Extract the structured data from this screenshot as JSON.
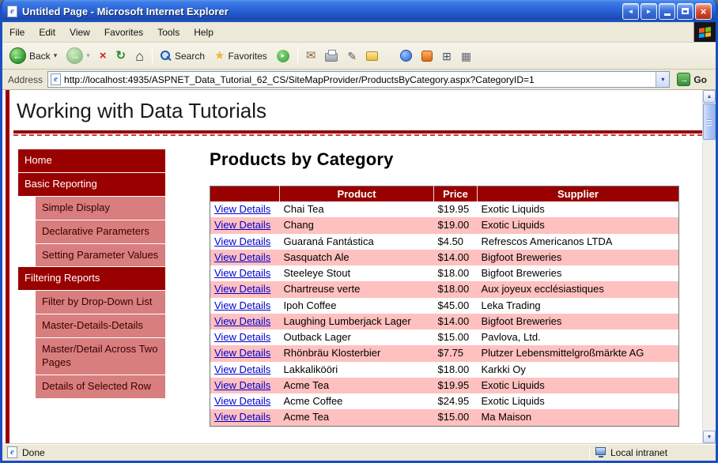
{
  "window": {
    "title": "Untitled Page - Microsoft Internet Explorer"
  },
  "menu_bar": {
    "items": [
      "File",
      "Edit",
      "View",
      "Favorites",
      "Tools",
      "Help"
    ]
  },
  "toolbar": {
    "back_label": "Back",
    "search_label": "Search",
    "favorites_label": "Favorites"
  },
  "address_bar": {
    "label": "Address",
    "url": "http://localhost:4935/ASPNET_Data_Tutorial_62_CS/SiteMapProvider/ProductsByCategory.aspx?CategoryID=1",
    "go_label": "Go"
  },
  "page": {
    "site_header": "Working with Data Tutorials",
    "heading": "Products by Category",
    "sidebar": {
      "items": [
        {
          "label": "Home",
          "type": "section"
        },
        {
          "label": "Basic Reporting",
          "type": "section"
        },
        {
          "label": "Simple Display",
          "type": "sub"
        },
        {
          "label": "Declarative Parameters",
          "type": "sub"
        },
        {
          "label": "Setting Parameter Values",
          "type": "sub"
        },
        {
          "label": "Filtering Reports",
          "type": "section"
        },
        {
          "label": "Filter by Drop-Down List",
          "type": "sub"
        },
        {
          "label": "Master-Details-Details",
          "type": "sub"
        },
        {
          "label": "Master/Detail Across Two Pages",
          "type": "sub"
        },
        {
          "label": "Details of Selected Row",
          "type": "sub"
        }
      ]
    },
    "products_table": {
      "columns": [
        "",
        "Product",
        "Price",
        "Supplier"
      ],
      "action_label": "View Details",
      "rows": [
        {
          "product": "Chai Tea",
          "price": "$19.95",
          "supplier": "Exotic Liquids"
        },
        {
          "product": "Chang",
          "price": "$19.00",
          "supplier": "Exotic Liquids"
        },
        {
          "product": "Guaraná Fantástica",
          "price": "$4.50",
          "supplier": "Refrescos Americanos LTDA"
        },
        {
          "product": "Sasquatch Ale",
          "price": "$14.00",
          "supplier": "Bigfoot Breweries"
        },
        {
          "product": "Steeleye Stout",
          "price": "$18.00",
          "supplier": "Bigfoot Breweries"
        },
        {
          "product": "Chartreuse verte",
          "price": "$18.00",
          "supplier": "Aux joyeux ecclésiastiques"
        },
        {
          "product": "Ipoh Coffee",
          "price": "$45.00",
          "supplier": "Leka Trading"
        },
        {
          "product": "Laughing Lumberjack Lager",
          "price": "$14.00",
          "supplier": "Bigfoot Breweries"
        },
        {
          "product": "Outback Lager",
          "price": "$15.00",
          "supplier": "Pavlova, Ltd."
        },
        {
          "product": "Rhönbräu Klosterbier",
          "price": "$7.75",
          "supplier": "Plutzer Lebensmittelgroßmärkte AG"
        },
        {
          "product": "Lakkalikööri",
          "price": "$18.00",
          "supplier": "Karkki Oy"
        },
        {
          "product": "Acme Tea",
          "price": "$19.95",
          "supplier": "Exotic Liquids"
        },
        {
          "product": "Acme Coffee",
          "price": "$24.95",
          "supplier": "Exotic Liquids"
        },
        {
          "product": "Acme Tea",
          "price": "$15.00",
          "supplier": "Ma Maison"
        }
      ]
    }
  },
  "status_bar": {
    "text": "Done",
    "zone": "Local intranet"
  },
  "icons": {
    "title_extra_left": "◄",
    "title_extra_right": "►",
    "close": "×",
    "back_arrow": "←",
    "forward_arrow": "→",
    "stop": "×",
    "refresh": "↻",
    "home": "⌂",
    "favorites_star": "★",
    "media_play": "▸",
    "mail_envelope": "✉",
    "edit_pencil": "✎",
    "calculator": "⊞",
    "grid": "▦",
    "dropdown": "▾",
    "go_arrow": "→",
    "scroll_up": "▲",
    "scroll_down": "▼",
    "ie_logo_e": "e"
  },
  "theme": {
    "accent_maroon": "#990000",
    "row_pink": "#ffc0c0",
    "sidebar_sub": "#d97e7e",
    "link_blue": "#0000cc",
    "chrome_tan": "#ece9d8"
  }
}
